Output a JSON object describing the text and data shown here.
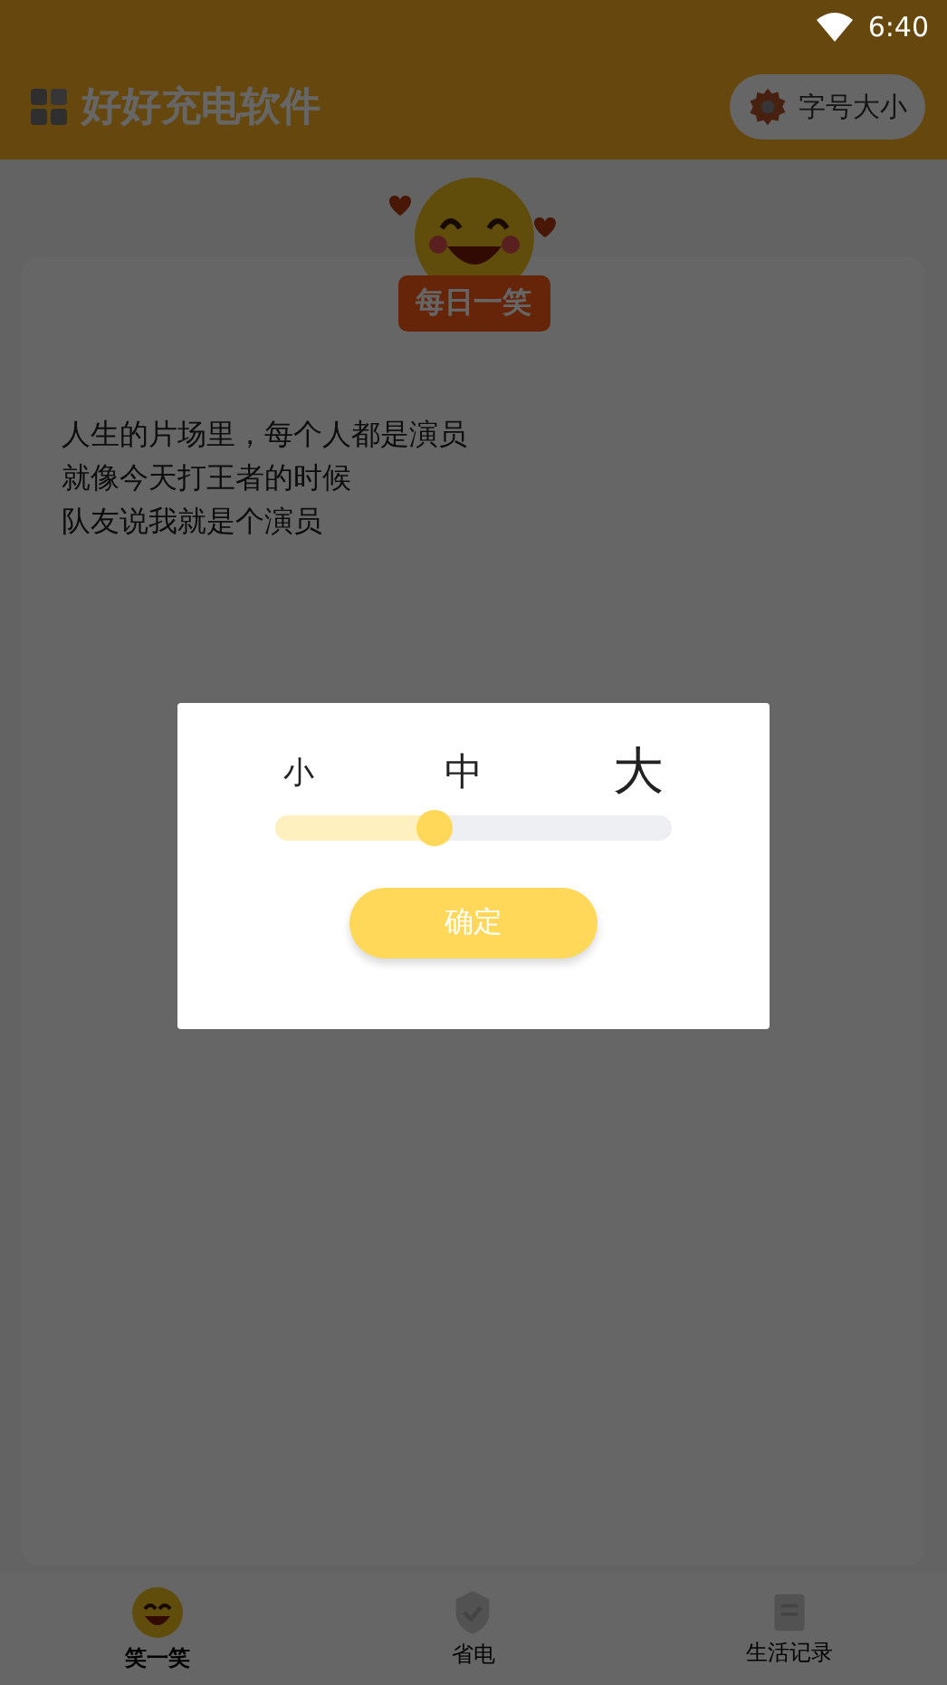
{
  "status_bar": {
    "time": "6:40"
  },
  "header": {
    "title": "好好充电软件",
    "font_button": "字号大小"
  },
  "joke": {
    "badge": "每日一笑",
    "lines": [
      "人生的片场里，每个人都是演员",
      "就像今天打王者的时候",
      "队友说我就是个演员"
    ]
  },
  "bottom_nav": [
    {
      "label": "笑一笑",
      "kind": "smile",
      "selected": true
    },
    {
      "label": "省电",
      "kind": "shield",
      "selected": false
    },
    {
      "label": "生活记录",
      "kind": "book",
      "selected": false
    }
  ],
  "dialog": {
    "sizes": [
      "小",
      "中",
      "大"
    ],
    "level": 0.4,
    "confirm": "确定"
  }
}
